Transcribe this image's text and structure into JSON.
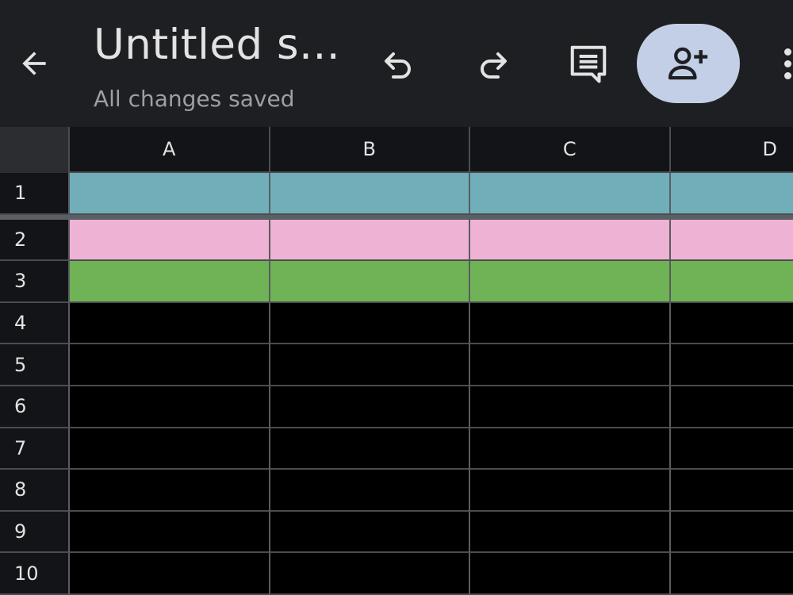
{
  "header": {
    "title": "Untitled s...",
    "status": "All changes saved",
    "buttons": {
      "back": "arrow-left-icon",
      "undo": "undo-icon",
      "redo": "redo-icon",
      "comment": "comment-icon",
      "share": "person-add-icon",
      "more": "more-vert-icon"
    },
    "share_button_color": "#c2cfe6"
  },
  "sheet": {
    "columns": [
      "A",
      "B",
      "C",
      "D"
    ],
    "rows": [
      "1",
      "2",
      "3",
      "4",
      "5",
      "6",
      "7",
      "8",
      "9",
      "10"
    ],
    "row_colors": {
      "1": "#70aeba",
      "2": "#eeb2d4",
      "3": "#70b356"
    },
    "frozen_rows": 1
  }
}
